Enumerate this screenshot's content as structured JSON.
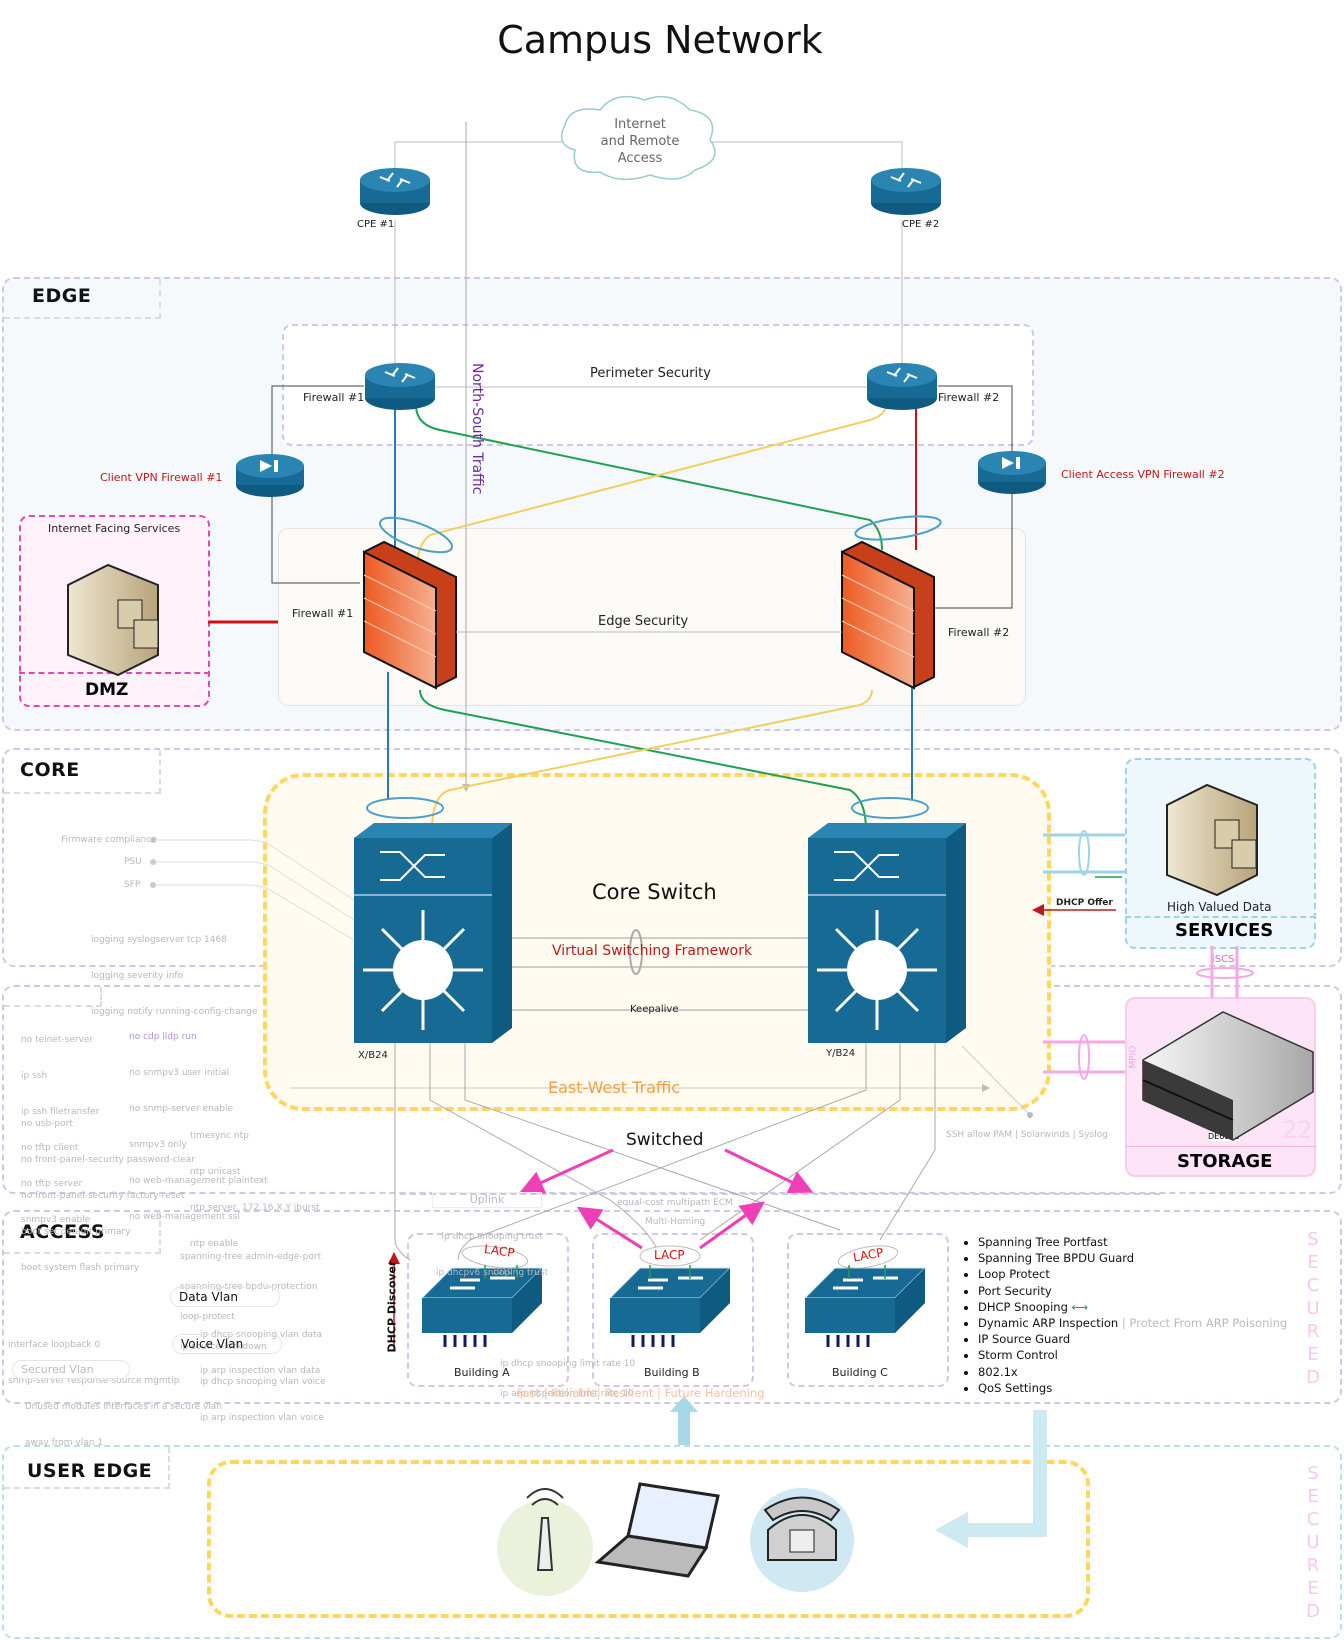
{
  "title": "Campus Network",
  "cloud": {
    "label_lines": [
      "Internet",
      "and Remote",
      "Access"
    ]
  },
  "routers": {
    "cpe1": "CPE #1",
    "cpe2": "CPE #2"
  },
  "edge": {
    "zone_label": "EDGE",
    "perimeter_label": "Perimeter Security",
    "edge_security_label": "Edge Security",
    "north_south_label": "North-South Traffic",
    "perimeter_fw1": "Firewall #1",
    "perimeter_fw2": "Firewall  #2",
    "vpn1": "Client VPN Firewall #1",
    "vpn2": "Client Access VPN Firewall #2",
    "edge_fw1": "Firewall #1",
    "edge_fw2": "Firewall #2",
    "dmz": {
      "title": "Internet Facing Services",
      "label": "DMZ"
    }
  },
  "core": {
    "zone_label": "CORE",
    "core_switch_label": "Core Switch",
    "vsf_label": "Virtual Switching Framework",
    "keepalive_label": "Keepalive",
    "east_west_label": "East-West Traffic",
    "switch_left": "X/B24",
    "switch_right": "Y/B24",
    "monitor_items": [
      "Firmware compliance",
      "PSU",
      "SFP"
    ],
    "logging_config": [
      "logging syslogserver tcp 1468",
      "logging severity info",
      "logging notify running-config-change"
    ],
    "mgmt_config_left": [
      "no telnet-server",
      "ip ssh",
      "ip ssh filetransfer",
      "no tftp client",
      "no tftp server",
      "snmpv3 enable"
    ],
    "mgmt_config_mid_highlight": "no cdp lldp run",
    "mgmt_config_mid": [
      "no snmpv3 user initial",
      "no snmp-server enable",
      "snmpv3 only",
      "no web-management plaintext",
      "no web-management ssl"
    ],
    "hardening_config": [
      "no usb-port",
      "no front-panel-security password-clear",
      "no front-panel-security factory-reset",
      "boot set default primary",
      "boot system flash primary"
    ],
    "ntp_config": [
      "timesync ntp",
      "ntp unicast",
      "ntp server  172.16.X.Y iburst",
      "ntp enable"
    ],
    "ssh_note": "SSH allow PAM | Solarwinds | Syslog"
  },
  "services": {
    "server_label": "High Valued Data",
    "title": "SERVICES",
    "dhcp_offer": "DHCP Offer",
    "iscsi": "iSCSi"
  },
  "storage": {
    "title": "STORAGE",
    "device": "DE6600",
    "mpio": "MPIO",
    "badge": "22"
  },
  "switched": {
    "label": "Switched",
    "uplink": "Uplink",
    "ecm": "equal-cost multipath ECM",
    "multihoming": "Multi-Homing",
    "dhcp_trust": [
      "ip dhcp snooping trust",
      "ip dhcpv6 snooping trust"
    ]
  },
  "access": {
    "zone_label": "ACCESS",
    "stp_config": [
      "spanning-tree admin-edge-port",
      "spanning-tree bpdu-protection",
      "loop-protect",
      "ip source-lockdown"
    ],
    "data_vlan": "Data Vlan",
    "data_vlan_config": [
      "ip dhcp snooping vlan data",
      "ip arp inspection vlan data"
    ],
    "voice_vlan": "Voice Vlan",
    "voice_vlan_config": [
      "ip dhcp snooping vlan voice",
      "ip arp inspection vlan voice"
    ],
    "loopback_config": [
      "interface loopback 0",
      "snmp-server response-source mgmtip"
    ],
    "secured_vlan": "Secured Vlan",
    "secured_vlan_note": [
      "Unused modules interfaces in a secure vlan",
      "away from vlan 1"
    ],
    "dhcp_discover": "DHCP Discover",
    "lacp": "LACP",
    "port_code": "1010",
    "limit_config": [
      "ip dhcp snooping limit rate 10",
      "ip arp inspection limit rate 10"
    ],
    "buildings": [
      "Building A",
      "Building B",
      "Building C"
    ],
    "tagline": "Fast | Reliable| Resilient | Future Hardening",
    "features": [
      "Spanning Tree Portfast",
      "Spanning Tree BPDU Guard",
      "Loop Protect",
      "Port Security",
      "DHCP Snooping",
      "Dynamic ARP Inspection",
      "IP Source Guard",
      "Storm Control",
      "802.1x",
      "QoS Settings"
    ],
    "arp_note": "| Protect From ARP Poisoning",
    "secured_letters": [
      "S",
      "E",
      "C",
      "U",
      "R",
      "E",
      "D"
    ]
  },
  "user_edge": {
    "zone_label": "USER EDGE",
    "devices": [
      "access-point",
      "laptop",
      "ip-phone"
    ],
    "secured_letters": [
      "S",
      "E",
      "C",
      "U",
      "R",
      "E",
      "D"
    ]
  },
  "colors": {
    "cisco_blue": "#176a93",
    "firewall_orange": "#f06a2e",
    "lacp_red": "#e01010",
    "pink_arrow": "#ee3fb8",
    "yellow_dash": "#ffd75e",
    "green_link": "#20a050",
    "blue_link": "#2a78b8"
  }
}
